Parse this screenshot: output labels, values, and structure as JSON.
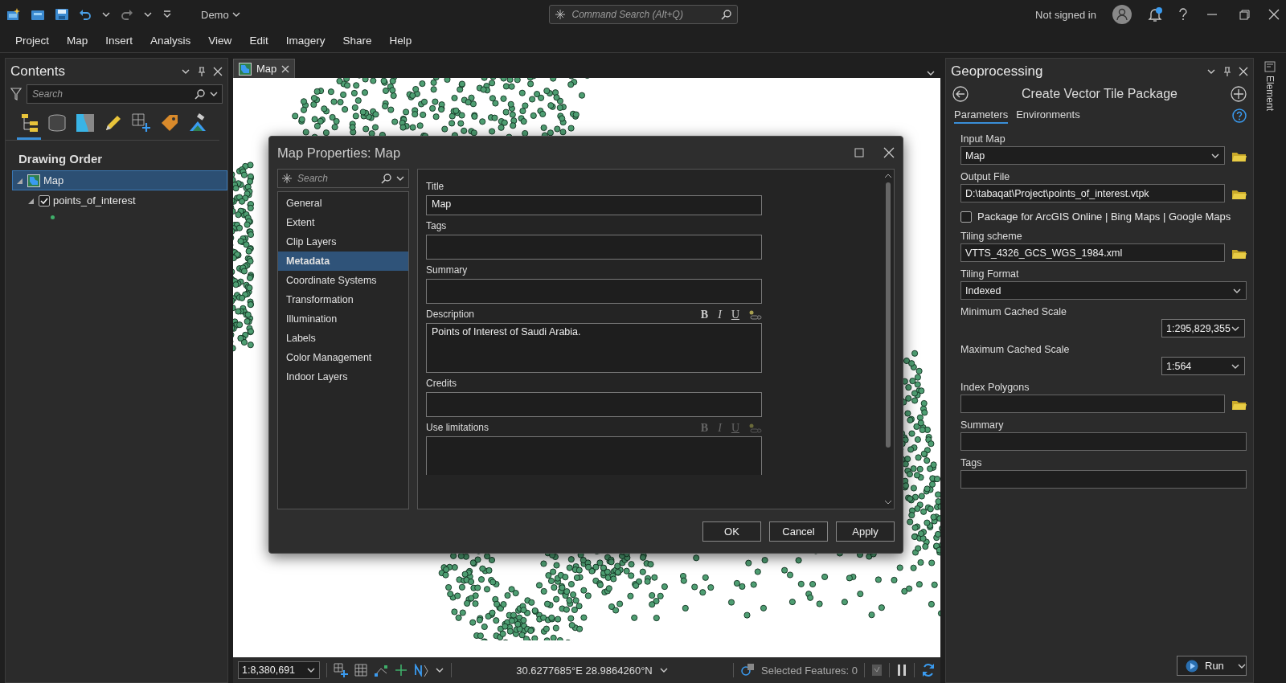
{
  "titlebar": {
    "project": "Demo",
    "search_placeholder": "Command Search (Alt+Q)",
    "user": "Not signed in",
    "notification": true
  },
  "menu": [
    "Project",
    "Map",
    "Insert",
    "Analysis",
    "View",
    "Edit",
    "Imagery",
    "Share",
    "Help"
  ],
  "contents": {
    "title": "Contents",
    "search_placeholder": "Search",
    "views": [
      {
        "kind": "drawing-order",
        "selected": true
      },
      {
        "kind": "source",
        "selected": false
      },
      {
        "kind": "selection",
        "selected": false
      },
      {
        "kind": "editing",
        "selected": false
      },
      {
        "kind": "snapping",
        "selected": false
      },
      {
        "kind": "labeling",
        "selected": false
      },
      {
        "kind": "perspective",
        "selected": false
      }
    ],
    "heading": "Drawing Order",
    "tree": [
      {
        "kind": "map",
        "label": "Map",
        "selected": true,
        "expanded": true,
        "children": [
          {
            "kind": "layer",
            "label": "points_of_interest",
            "selected": false,
            "checked": true,
            "expanded": true
          }
        ]
      }
    ]
  },
  "map_tab": {
    "label": "Map"
  },
  "dialog": {
    "title": "Map Properties: Map",
    "search_placeholder": "Search",
    "pages": [
      {
        "label": "General",
        "selected": false
      },
      {
        "label": "Extent",
        "selected": false
      },
      {
        "label": "Clip Layers",
        "selected": false
      },
      {
        "label": "Metadata",
        "selected": true
      },
      {
        "label": "Coordinate Systems",
        "selected": false
      },
      {
        "label": "Transformation",
        "selected": false
      },
      {
        "label": "Illumination",
        "selected": false
      },
      {
        "label": "Labels",
        "selected": false
      },
      {
        "label": "Color Management",
        "selected": false
      },
      {
        "label": "Indoor Layers",
        "selected": false
      }
    ],
    "fields": [
      {
        "kind": "line",
        "label": "Title",
        "value": "Map"
      },
      {
        "kind": "box",
        "label": "Tags"
      },
      {
        "kind": "box",
        "label": "Summary"
      },
      {
        "kind": "rich",
        "label": "Description",
        "value": "Points of Interest of Saudi Arabia.",
        "format": [
          "B",
          "I",
          "U"
        ],
        "disabled": false
      },
      {
        "kind": "box",
        "label": "Credits"
      },
      {
        "kind": "rich",
        "label": "Use limitations",
        "format": [
          "B",
          "I",
          "U"
        ],
        "disabled": true
      }
    ],
    "buttons": [
      "OK",
      "Cancel",
      "Apply"
    ]
  },
  "geoprocessing": {
    "title": "Geoprocessing",
    "tool": "Create Vector Tile Package",
    "tabs": [
      {
        "label": "Parameters",
        "selected": true
      },
      {
        "label": "Environments",
        "selected": false
      }
    ],
    "params": [
      {
        "kind": "dropdown",
        "label": "Input Map",
        "value": "Map",
        "browse": true
      },
      {
        "kind": "text",
        "label": "Output File",
        "value": "D:\\tabaqat\\Project\\points_of_interest.vtpk",
        "browse": true
      },
      {
        "kind": "checkbox",
        "label": "Package for ArcGIS Online | Bing Maps | Google Maps",
        "checked": false
      },
      {
        "kind": "text",
        "label": "Tiling scheme",
        "value": "VTTS_4326_GCS_WGS_1984.xml",
        "browse": true
      },
      {
        "kind": "dropdown",
        "label": "Tiling Format",
        "value": "Indexed",
        "browse": false
      },
      {
        "kind": "scale",
        "label": "Minimum Cached Scale",
        "value": "1:295,829,355"
      },
      {
        "kind": "scale",
        "label": "Maximum Cached Scale",
        "value": "1:564"
      },
      {
        "kind": "text",
        "label": "Index Polygons",
        "browse": true
      },
      {
        "kind": "text",
        "label": "Summary",
        "browse": false
      },
      {
        "kind": "text",
        "label": "Tags",
        "browse": false
      }
    ],
    "run": "Run"
  },
  "side_strip": {
    "label": "Element"
  },
  "status_bar": {
    "scale": "1:8,380,691",
    "coordinates": "30.6277685°E 28.9864260°N",
    "selected_features": "Selected Features: 0"
  }
}
